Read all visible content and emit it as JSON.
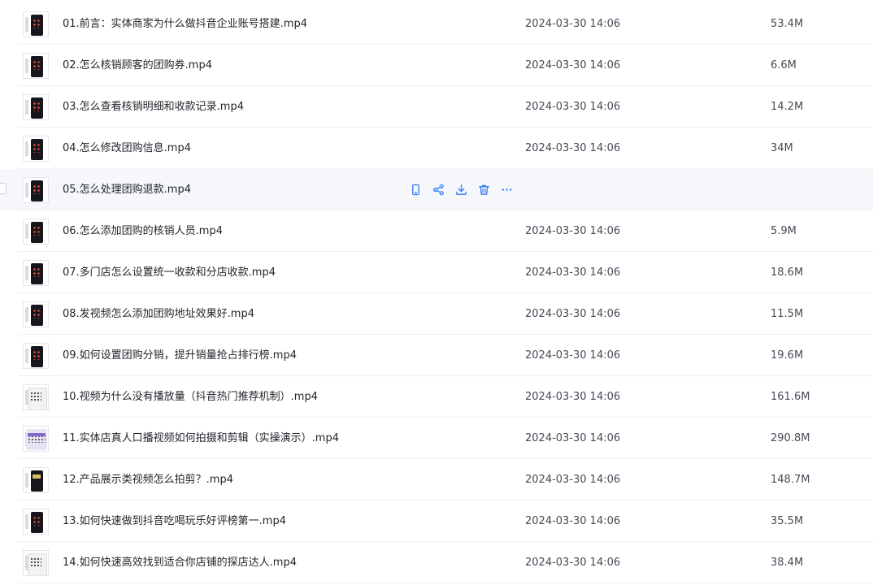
{
  "files": [
    {
      "name": "01.前言：实体商家为什么做抖音企业账号搭建.mp4",
      "date": "2024-03-30 14:06",
      "size": "53.4M",
      "thumb_icon": "video-thumbnail-icon",
      "thumb_style": "dark"
    },
    {
      "name": "02.怎么核销顾客的团购券.mp4",
      "date": "2024-03-30 14:06",
      "size": "6.6M",
      "thumb_icon": "video-thumbnail-icon",
      "thumb_style": "dark"
    },
    {
      "name": "03.怎么查看核销明细和收款记录.mp4",
      "date": "2024-03-30 14:06",
      "size": "14.2M",
      "thumb_icon": "video-thumbnail-icon",
      "thumb_style": "dark"
    },
    {
      "name": "04.怎么修改团购信息.mp4",
      "date": "2024-03-30 14:06",
      "size": "34M",
      "thumb_icon": "video-thumbnail-icon",
      "thumb_style": "dark"
    },
    {
      "name": "05.怎么处理团购退款.mp4",
      "date": "",
      "size": "",
      "thumb_icon": "video-thumbnail-icon",
      "thumb_style": "dark",
      "hovered": true
    },
    {
      "name": "06.怎么添加团购的核销人员.mp4",
      "date": "2024-03-30 14:06",
      "size": "5.9M",
      "thumb_icon": "video-thumbnail-icon",
      "thumb_style": "dark"
    },
    {
      "name": "07.多门店怎么设置统一收款和分店收款.mp4",
      "date": "2024-03-30 14:06",
      "size": "18.6M",
      "thumb_icon": "video-thumbnail-icon",
      "thumb_style": "dark"
    },
    {
      "name": "08.发视频怎么添加团购地址效果好.mp4",
      "date": "2024-03-30 14:06",
      "size": "11.5M",
      "thumb_icon": "video-thumbnail-icon",
      "thumb_style": "dark"
    },
    {
      "name": "09.如何设置团购分销，提升销量抢占排行榜.mp4",
      "date": "2024-03-30 14:06",
      "size": "19.6M",
      "thumb_icon": "video-thumbnail-icon",
      "thumb_style": "dark"
    },
    {
      "name": "10.视频为什么没有播放量（抖音热门推荐机制）.mp4",
      "date": "2024-03-30 14:06",
      "size": "161.6M",
      "thumb_icon": "video-thumbnail-icon",
      "thumb_style": "light"
    },
    {
      "name": "11.实体店真人口播视频如何拍摄和剪辑（实操演示）.mp4",
      "date": "2024-03-30 14:06",
      "size": "290.8M",
      "thumb_icon": "video-thumbnail-icon",
      "thumb_style": "purple"
    },
    {
      "name": "12.产品展示类视频怎么拍剪？.mp4",
      "date": "2024-03-30 14:06",
      "size": "148.7M",
      "thumb_icon": "video-thumbnail-icon",
      "thumb_style": "gold"
    },
    {
      "name": "13.如何快速做到抖音吃喝玩乐好评榜第一.mp4",
      "date": "2024-03-30 14:06",
      "size": "35.5M",
      "thumb_icon": "video-thumbnail-icon",
      "thumb_style": "dark"
    },
    {
      "name": "14.如何快速高效找到适合你店铺的探店达人.mp4",
      "date": "2024-03-30 14:06",
      "size": "38.4M",
      "thumb_icon": "video-thumbnail-icon",
      "thumb_style": "light"
    }
  ],
  "row_actions": [
    {
      "icon": "phone-icon",
      "action": "phone"
    },
    {
      "icon": "share-icon",
      "action": "share"
    },
    {
      "icon": "download-icon",
      "action": "download"
    },
    {
      "icon": "trash-icon",
      "action": "delete"
    },
    {
      "icon": "more-icon",
      "action": "more"
    }
  ],
  "colors": {
    "accent": "#3b82f6",
    "hover_row": "#f5f7fb",
    "text_primary": "#1f2329",
    "text_secondary": "#454a55",
    "divider": "#eef0f3"
  }
}
